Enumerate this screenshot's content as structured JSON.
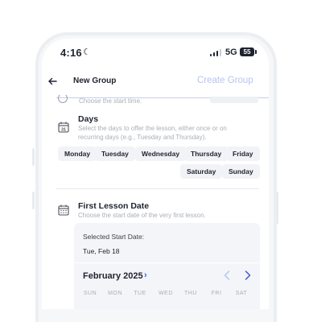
{
  "status_bar": {
    "time": "4:16",
    "network": "5G",
    "battery": "55"
  },
  "header": {
    "title": "New Group",
    "action": "Create Group"
  },
  "previous_section": {
    "hint": "Choose the start time."
  },
  "days_section": {
    "title": "Days",
    "description": "Select the days to offer the lesson, either once or on recurring days (e.g., Tuesday and Thursday).",
    "days": [
      "Monday",
      "Tuesday",
      "Wednesday",
      "Thursday",
      "Friday",
      "Saturday",
      "Sunday"
    ]
  },
  "first_lesson_section": {
    "title": "First Lesson Date",
    "description": "Choose the start date of the very first lesson.",
    "selected_label": "Selected Start Date:",
    "selected_value": "Tue, Feb 18",
    "month": "February 2025",
    "weekdays": [
      "SUN",
      "MON",
      "TUE",
      "WED",
      "THU",
      "FRI",
      "SAT"
    ]
  },
  "colors": {
    "accent": "#3f5bd9",
    "action_disabled": "#b9c3f1",
    "chip_bg": "#f1f3f6",
    "card_bg": "#f4f5f8"
  }
}
